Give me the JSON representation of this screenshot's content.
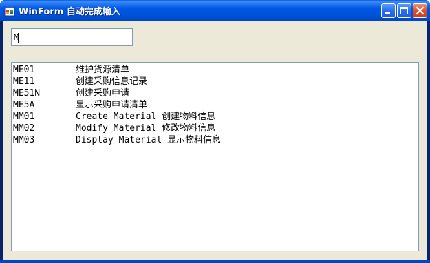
{
  "window": {
    "title": "WinForm 自动完成输入"
  },
  "title_buttons": {
    "minimize_icon": "minimize-icon",
    "maximize_icon": "maximize-icon",
    "close_icon": "close-icon"
  },
  "input": {
    "value": "M"
  },
  "list": {
    "items": [
      {
        "code": "ME01",
        "text": "维护货源清单"
      },
      {
        "code": "ME11",
        "text": "创建采购信息记录"
      },
      {
        "code": "ME51N",
        "text": "创建采购申请"
      },
      {
        "code": "ME5A",
        "text": "显示采购申请清单"
      },
      {
        "code": "MM01",
        "text": "Create Material 创建物料信息"
      },
      {
        "code": "MM02",
        "text": "Modify Material 修改物料信息"
      },
      {
        "code": "MM03",
        "text": "Display Material 显示物料信息"
      }
    ]
  },
  "colors": {
    "titlebar": "#0058e6",
    "client": "#ece9d8",
    "border": "#7f9db9"
  }
}
